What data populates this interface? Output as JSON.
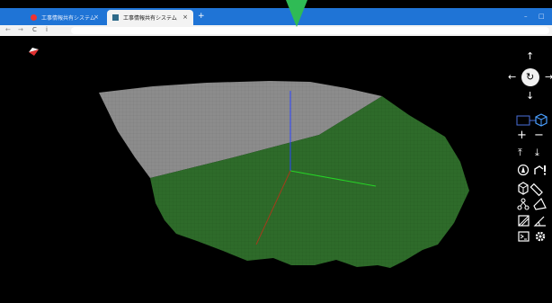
{
  "browser": {
    "tabs": [
      {
        "label": "工事情報共有システム",
        "active": false
      },
      {
        "label": "工事情報共有システム",
        "active": true
      }
    ],
    "new_tab_label": "+",
    "close_label": "×",
    "nav": {
      "back": "←",
      "forward": "→",
      "reload": "C",
      "info": "i"
    },
    "window_controls": {
      "minimize": "–",
      "maximize": "□"
    }
  },
  "colors": {
    "accent_blue": "#1f74d6",
    "terrain_green": "#2e6b2a",
    "terrain_gray": "#8c8c8c",
    "pointer_green": "#2fbb55"
  },
  "toolbar": {
    "pan_up": "↑",
    "pan_down": "↓",
    "pan_left": "←",
    "pan_right": "→",
    "rotate_center": "↻",
    "zoom_in": "+",
    "zoom_out": "−",
    "raise": "⤒",
    "lower": "⤓"
  }
}
